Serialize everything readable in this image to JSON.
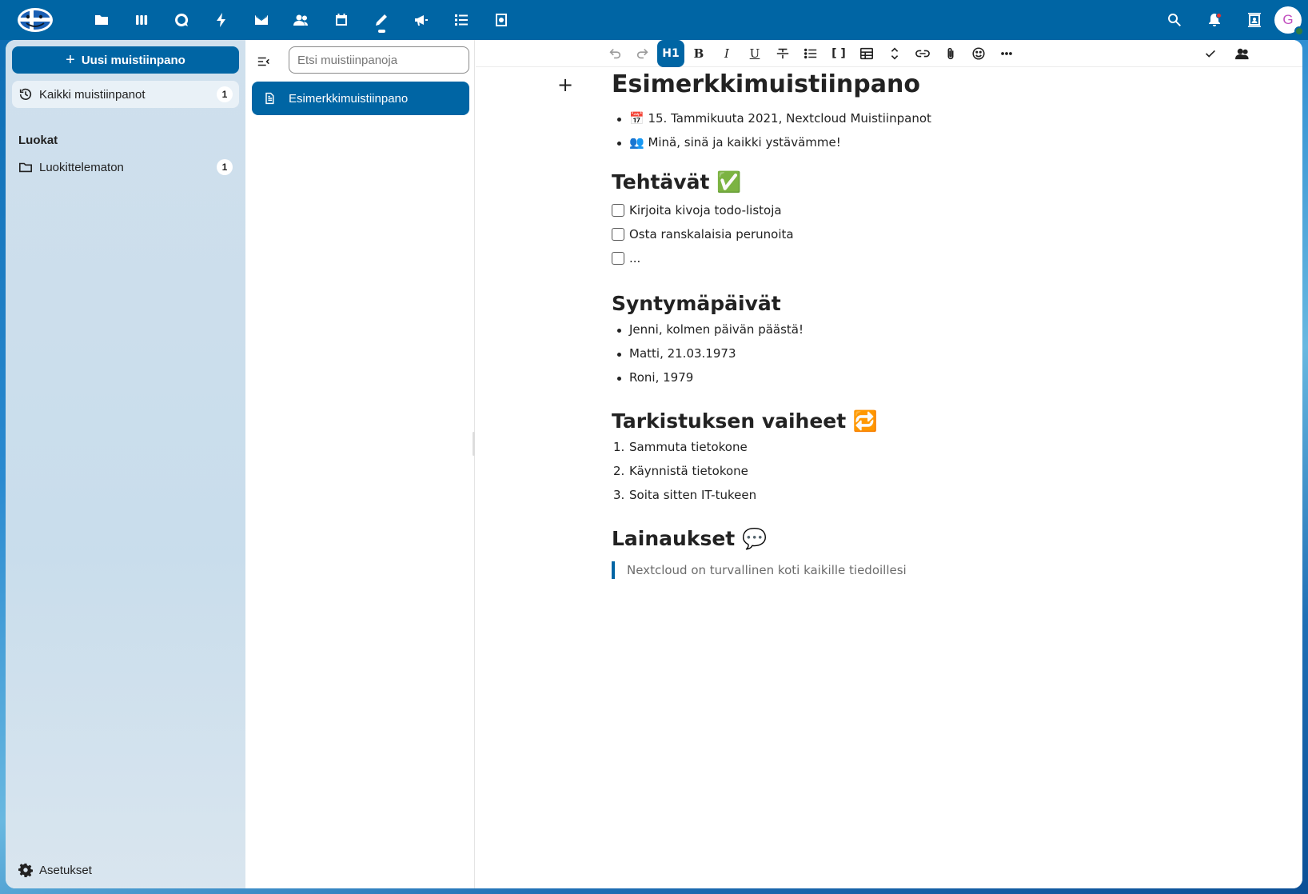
{
  "header": {
    "apps": [
      {
        "name": "files-icon"
      },
      {
        "name": "deck-icon"
      },
      {
        "name": "talk-icon"
      },
      {
        "name": "activity-icon"
      },
      {
        "name": "mail-icon"
      },
      {
        "name": "contacts-icon"
      },
      {
        "name": "calendar-icon"
      },
      {
        "name": "notes-icon",
        "active": true
      },
      {
        "name": "announcements-icon"
      },
      {
        "name": "tasks-icon"
      },
      {
        "name": "cookbook-icon"
      }
    ],
    "avatar_initial": "G"
  },
  "sidebar": {
    "new_note_label": "Uusi muistiinpano",
    "all_notes_label": "Kaikki muistiinpanot",
    "all_notes_count": "1",
    "categories_caption": "Luokat",
    "uncategorized_label": "Luokittelematon",
    "uncategorized_count": "1",
    "settings_label": "Asetukset"
  },
  "notes_list": {
    "search_placeholder": "Etsi muistiinpanoja",
    "items": [
      {
        "title": "Esimerkkimuistiinpano"
      }
    ]
  },
  "toolbar": {
    "heading_label": "H1",
    "bold_label": "B",
    "italic_label": "I",
    "underline_label": "U",
    "code_label": "[ ]"
  },
  "note": {
    "title": "Esimerkkimuistiinpano",
    "meta": [
      "📅 15. Tammikuuta 2021, Nextcloud Muistiinpanot",
      "👥 Minä, sinä ja kaikki ystävämme!"
    ],
    "tasks_heading": "Tehtävät ✅",
    "tasks": [
      "Kirjoita kivoja todo-listoja",
      "Osta ranskalaisia perunoita",
      "..."
    ],
    "birthdays_heading": "Syntymäpäivät",
    "birthdays": [
      "Jenni, kolmen päivän päästä!",
      "Matti, 21.03.1973",
      "Roni, 1979"
    ],
    "steps_heading": "Tarkistuksen vaiheet 🔁",
    "steps": [
      "Sammuta tietokone",
      "Käynnistä tietokone",
      "Soita sitten IT-tukeen"
    ],
    "step_numbers": [
      "1.",
      "2.",
      "3."
    ],
    "quotes_heading": "Lainaukset 💬",
    "quote": "Nextcloud on turvallinen koti kaikille tiedoillesi"
  },
  "colors": {
    "primary": "#0065a4",
    "notification": "#e9322d",
    "online": "#2d7b41"
  }
}
